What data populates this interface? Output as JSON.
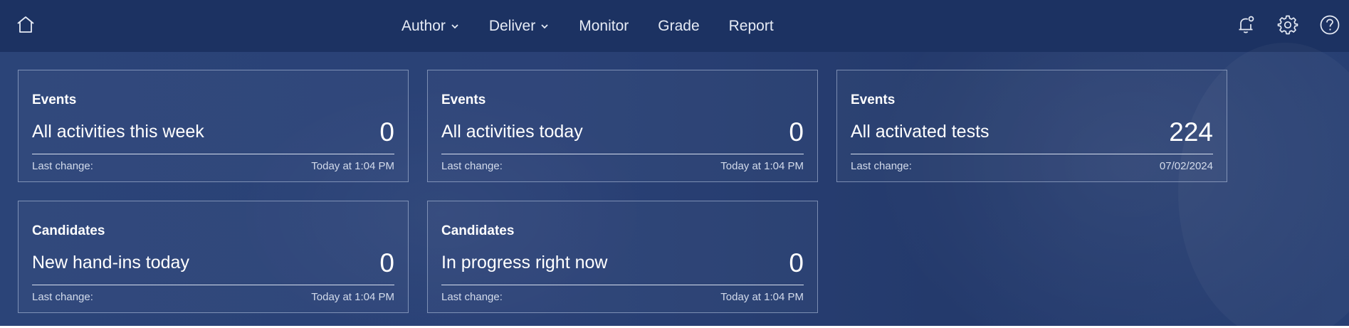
{
  "header": {
    "home_icon": "home-icon",
    "nav": [
      {
        "label": "Author",
        "has_dropdown": true
      },
      {
        "label": "Deliver",
        "has_dropdown": true
      },
      {
        "label": "Monitor",
        "has_dropdown": false
      },
      {
        "label": "Grade",
        "has_dropdown": false
      },
      {
        "label": "Report",
        "has_dropdown": false
      }
    ],
    "right_icons": [
      "notification-bell-icon",
      "settings-gear-icon",
      "help-icon"
    ]
  },
  "cards": [
    {
      "category": "Events",
      "label": "All activities this week",
      "value": "0",
      "meta_label": "Last change:",
      "meta_value": "Today at 1:04 PM"
    },
    {
      "category": "Events",
      "label": "All activities today",
      "value": "0",
      "meta_label": "Last change:",
      "meta_value": "Today at 1:04 PM"
    },
    {
      "category": "Events",
      "label": "All activated tests",
      "value": "224",
      "meta_label": "Last change:",
      "meta_value": "07/02/2024"
    },
    {
      "category": "Candidates",
      "label": "New hand-ins today",
      "value": "0",
      "meta_label": "Last change:",
      "meta_value": "Today at 1:04 PM"
    },
    {
      "category": "Candidates",
      "label": "In progress right now",
      "value": "0",
      "meta_label": "Last change:",
      "meta_value": "Today at 1:04 PM"
    }
  ],
  "colors": {
    "header_bg": "#1c3262",
    "page_bg": "#2a4176",
    "card_border": "#bfcce6",
    "text": "#ffffff"
  }
}
